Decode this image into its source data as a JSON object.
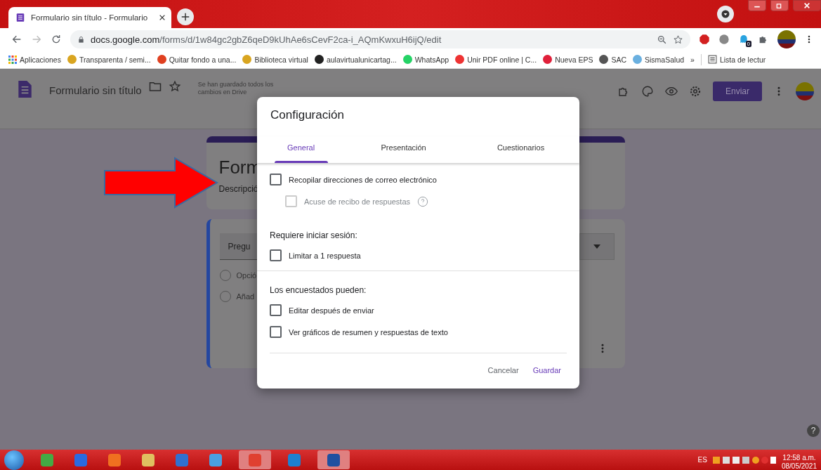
{
  "browser": {
    "tab_title": "Formulario sin título - Formulario",
    "url_host": "docs.google.com",
    "url_path": "/forms/d/1w84gc2gbZ6qeD9kUhAe6sCevF2ca-i_AQmKwxuH6ijQ/edit",
    "extension_badge": "0",
    "bookmarks": [
      "Aplicaciones",
      "Transparenta / semi...",
      "Quitar fondo a una...",
      "Biblioteca virtual",
      "aulavirtualunicartag...",
      "WhatsApp",
      "Unir PDF online | C...",
      "Nueva EPS",
      "SAC",
      "SismaSalud"
    ],
    "more_bookmarks": "»",
    "reading_list": "Lista de lectur"
  },
  "forms_header": {
    "title": "Formulario sin título",
    "save_status": "Se han guardado todos los cambios en Drive",
    "send_button": "Enviar"
  },
  "background_form": {
    "title": "Form",
    "description": "Descripció",
    "question": "Pregu",
    "options": [
      {
        "label": "Opció",
        "checked": false
      },
      {
        "label": "Añad",
        "checked": false
      }
    ],
    "help_button": "?"
  },
  "dialog": {
    "title": "Configuración",
    "tabs": [
      {
        "label": "General",
        "selected": true
      },
      {
        "label": "Presentación",
        "selected": false
      },
      {
        "label": "Cuestionarios",
        "selected": false
      }
    ],
    "sections": [
      {
        "options": [
          {
            "label": "Recopilar direcciones de correo electrónico",
            "checked": false,
            "disabled": false,
            "children": [
              {
                "label": "Acuse de recibo de respuestas",
                "checked": false,
                "disabled": true,
                "help": true
              }
            ]
          }
        ]
      },
      {
        "heading": "Requiere iniciar sesión:",
        "options": [
          {
            "label": "Limitar a 1 respuesta",
            "checked": false,
            "disabled": false
          }
        ]
      },
      {
        "heading": "Los encuestados pueden:",
        "options": [
          {
            "label": "Editar después de enviar",
            "checked": false,
            "disabled": false
          },
          {
            "label": "Ver gráficos de resumen y respuestas de texto",
            "checked": false,
            "disabled": false
          }
        ]
      }
    ],
    "buttons": [
      {
        "label": "Cancelar",
        "kind": "secondary"
      },
      {
        "label": "Guardar",
        "kind": "primary"
      }
    ]
  },
  "taskbar": {
    "language": "ES",
    "time": "12:58 a.m.",
    "date": "08/05/2021"
  }
}
